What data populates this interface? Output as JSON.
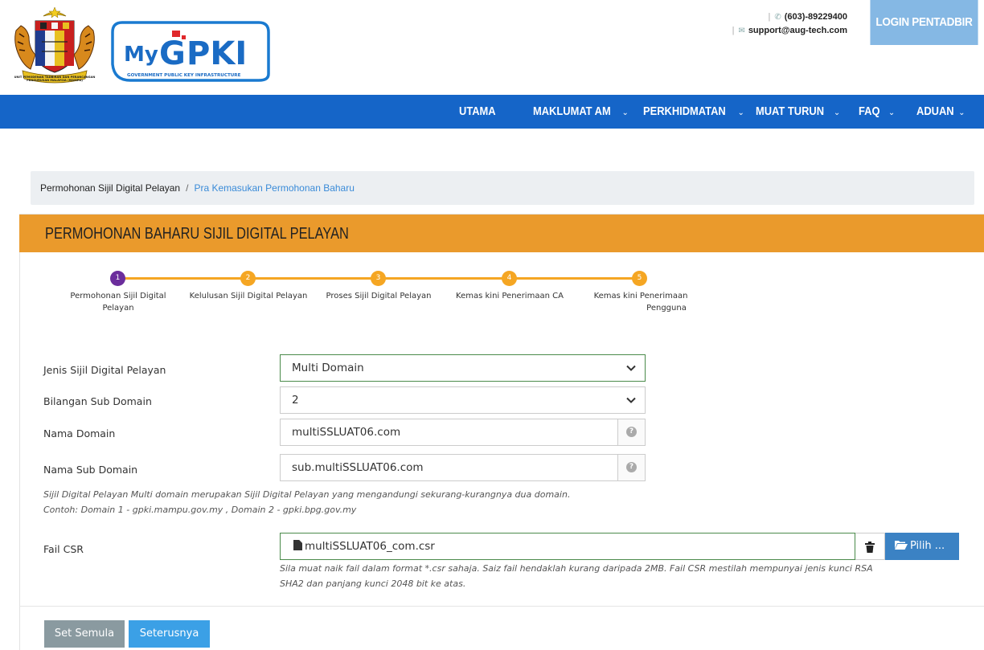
{
  "header": {
    "crest_caption": "UNIT PEMODENAN TADBIRAN DAN PERANCANGAN PENGURUSAN MALAYSIA (MAMPU)",
    "logo_text": "MyGPKI",
    "logo_subtitle": "GOVERNMENT PUBLIC KEY INFRASTRUCTURE",
    "phone": "(603)-89229400",
    "email": "support@aug-tech.com",
    "login_label": "LOGIN PENTADBIR"
  },
  "nav": {
    "items": [
      {
        "label": "UTAMA",
        "dropdown": false
      },
      {
        "label": "MAKLUMAT AM",
        "dropdown": true
      },
      {
        "label": "PERKHIDMATAN",
        "dropdown": true
      },
      {
        "label": "MUAT TURUN",
        "dropdown": true
      },
      {
        "label": "FAQ",
        "dropdown": true
      },
      {
        "label": "ADUAN",
        "dropdown": true
      }
    ]
  },
  "breadcrumb": {
    "parent": "Permohonan Sijil Digital Pelayan",
    "current": "Pra Kemasukan Permohonan Baharu"
  },
  "panel": {
    "title": "PERMOHONAN BAHARU SIJIL DIGITAL PELAYAN"
  },
  "stepper": {
    "steps": [
      {
        "number": "1",
        "label_line1": "Permohonan Sijil Digital",
        "label_line2": "Pelayan",
        "active": true
      },
      {
        "number": "2",
        "label_line1": "Kelulusan Sijil Digital Pelayan",
        "label_line2": "",
        "active": false
      },
      {
        "number": "3",
        "label_line1": "Proses Sijil Digital Pelayan",
        "label_line2": "",
        "active": false
      },
      {
        "number": "4",
        "label_line1": "Kemas kini Penerimaan CA",
        "label_line2": "",
        "active": false
      },
      {
        "number": "5",
        "label_line1": "Kemas kini Penerimaan",
        "label_line2": "Pengguna",
        "active": false
      }
    ]
  },
  "form": {
    "jenis": {
      "label": "Jenis Sijil Digital Pelayan",
      "value": "Multi Domain"
    },
    "bilangan": {
      "label": "Bilangan Sub Domain",
      "value": "2"
    },
    "domain": {
      "label": "Nama Domain",
      "value": "multiSSLUAT06.com"
    },
    "subdomain": {
      "label": "Nama Sub Domain",
      "value": "sub.multiSSLUAT06.com"
    },
    "note_line1": "Sijil Digital Pelayan Multi domain merupakan Sijil Digital Pelayan yang mengandungi sekurang-kurangnya dua domain.",
    "note_line2": "Contoh: Domain 1 - gpki.mampu.gov.my , Domain 2 - gpki.bpg.gov.my",
    "csr": {
      "label": "Fail CSR",
      "filename": "multiSSLUAT06_com.csr",
      "choose_label": "Pilih ...",
      "note_line1": "Sila muat naik fail dalam format *.csr sahaja. Saiz fail hendaklah kurang daripada 2MB. Fail CSR mestilah mempunyai jenis kunci RSA",
      "note_line2": "SHA2 dan panjang kunci 2048 bit ke atas."
    }
  },
  "actions": {
    "reset_label": "Set Semula",
    "next_label": "Seterusnya"
  },
  "colors": {
    "nav_blue": "#1565c8",
    "panel_orange": "#ea9a2c",
    "step_orange": "#f5a623",
    "step_active": "#6b2d9c",
    "login_blue": "#85b8e4"
  }
}
